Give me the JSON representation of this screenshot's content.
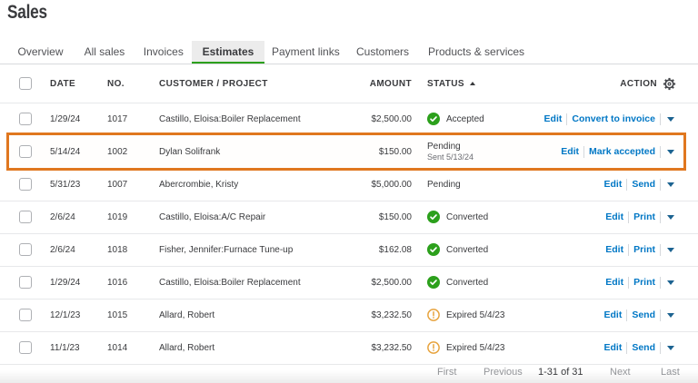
{
  "page": {
    "title": "Sales"
  },
  "tabs": {
    "items": [
      {
        "label": "Overview",
        "active": false
      },
      {
        "label": "All sales",
        "active": false
      },
      {
        "label": "Invoices",
        "active": false
      },
      {
        "label": "Estimates",
        "active": true
      },
      {
        "label": "Payment links",
        "active": false
      },
      {
        "label": "Customers",
        "active": false
      },
      {
        "label": "Products & services",
        "active": false
      }
    ]
  },
  "table": {
    "columns": {
      "date": "DATE",
      "no": "NO.",
      "customer": "CUSTOMER / PROJECT",
      "amount": "AMOUNT",
      "status": "STATUS",
      "action": "ACTION"
    },
    "sort": {
      "column": "STATUS",
      "direction": "ascending"
    },
    "rows": [
      {
        "date": "1/29/24",
        "no": "1017",
        "customer": "Castillo, Eloisa:Boiler Replacement",
        "amount": "$2,500.00",
        "status": {
          "type": "accepted",
          "label": "Accepted"
        },
        "actions": {
          "edit": "Edit",
          "primary": "Convert to invoice"
        },
        "highlighted": false
      },
      {
        "date": "5/14/24",
        "no": "1002",
        "customer": "Dylan Solifrank",
        "amount": "$150.00",
        "status": {
          "type": "pending",
          "label": "Pending",
          "sublabel": "Sent 5/13/24"
        },
        "actions": {
          "edit": "Edit",
          "primary": "Mark accepted"
        },
        "highlighted": true
      },
      {
        "date": "5/31/23",
        "no": "1007",
        "customer": "Abercrombie, Kristy",
        "amount": "$5,000.00",
        "status": {
          "type": "pending",
          "label": "Pending"
        },
        "actions": {
          "edit": "Edit",
          "primary": "Send"
        },
        "highlighted": false
      },
      {
        "date": "2/6/24",
        "no": "1019",
        "customer": "Castillo, Eloisa:A/C Repair",
        "amount": "$150.00",
        "status": {
          "type": "converted",
          "label": "Converted"
        },
        "actions": {
          "edit": "Edit",
          "primary": "Print"
        },
        "highlighted": false
      },
      {
        "date": "2/6/24",
        "no": "1018",
        "customer": "Fisher, Jennifer:Furnace Tune-up",
        "amount": "$162.08",
        "status": {
          "type": "converted",
          "label": "Converted"
        },
        "actions": {
          "edit": "Edit",
          "primary": "Print"
        },
        "highlighted": false
      },
      {
        "date": "1/29/24",
        "no": "1016",
        "customer": "Castillo, Eloisa:Boiler Replacement",
        "amount": "$2,500.00",
        "status": {
          "type": "converted",
          "label": "Converted"
        },
        "actions": {
          "edit": "Edit",
          "primary": "Print"
        },
        "highlighted": false
      },
      {
        "date": "12/1/23",
        "no": "1015",
        "customer": "Allard, Robert",
        "amount": "$3,232.50",
        "status": {
          "type": "expired",
          "label": "Expired 5/4/23"
        },
        "actions": {
          "edit": "Edit",
          "primary": "Send"
        },
        "highlighted": false
      },
      {
        "date": "11/1/23",
        "no": "1014",
        "customer": "Allard, Robert",
        "amount": "$3,232.50",
        "status": {
          "type": "expired",
          "label": "Expired 5/4/23"
        },
        "actions": {
          "edit": "Edit",
          "primary": "Send"
        },
        "highlighted": false
      }
    ]
  },
  "pagination": {
    "first": "First",
    "previous": "Previous",
    "range": "1-31 of 31",
    "next": "Next",
    "last": "Last"
  },
  "colors": {
    "brand_green": "#2ca01c",
    "link_blue": "#0077c5",
    "highlight_orange": "#e0771f",
    "expired_amber": "#e7a33d",
    "text_dark": "#393a3d",
    "text_gray": "#6b6c72"
  }
}
